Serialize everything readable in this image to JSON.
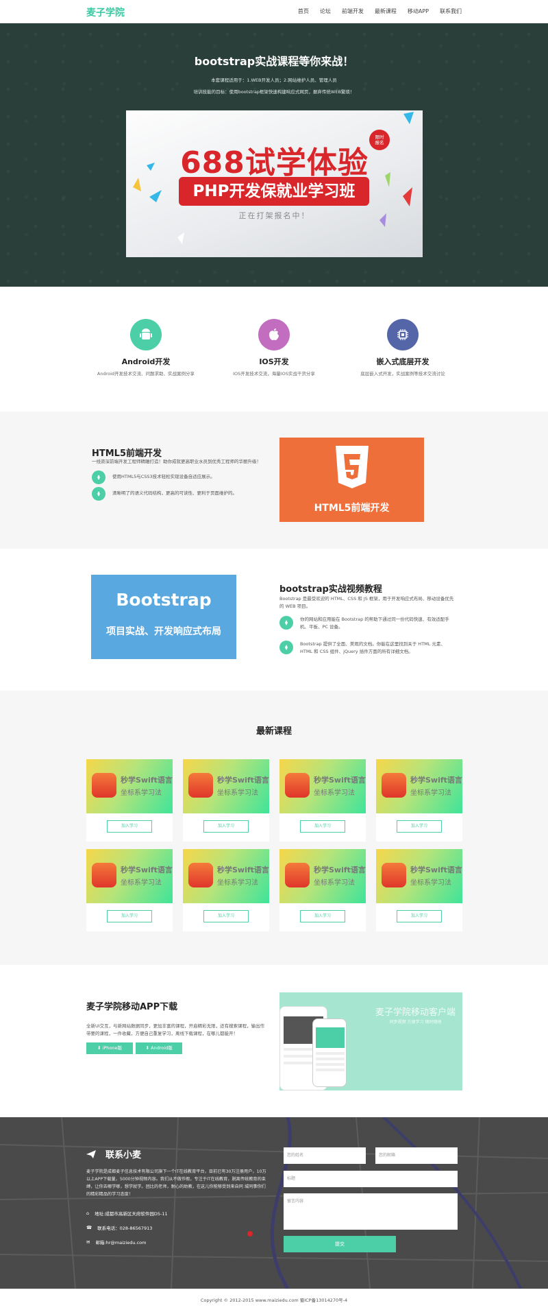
{
  "nav": {
    "brand": "麦子学院",
    "items": [
      "首页",
      "论坛",
      "前端开发",
      "最新课程",
      "移动APP",
      "联系我们"
    ]
  },
  "hero": {
    "title": "bootstrap实战课程等你来战！",
    "line1": "本套课程适用于：1.WEB开发人员；2.网站维护人员、管理人员",
    "line2": "培训技能的目标：使用bootstrap框架快速构建响应式网页，摒弃传统WEB繁琐！",
    "banner": {
      "big": "688试学体验",
      "badge_line1": "限时",
      "badge_line2": "报名",
      "red": "PHP开发保就业学习班",
      "small": "正在打架报名中！"
    }
  },
  "features": [
    {
      "title": "Android开发",
      "desc": "Android开发技术交流、问题求助、实战案例分享",
      "icon": "android-icon",
      "color": "#4ccfa6"
    },
    {
      "title": "IOS开发",
      "desc": "IOS开发技术交流，海量IOS实战干货分享",
      "icon": "apple-icon",
      "color": "#c26dc0"
    },
    {
      "title": "嵌入式底层开发",
      "desc": "底层嵌入式开发，实战案例等技术交流讨论",
      "icon": "chip-icon",
      "color": "#5566a8"
    }
  ],
  "html5": {
    "title": "HTML5前端开发",
    "desc": "一线资深前端开发工程师精雕打造！助你成就更高职业水员到优秀工程师的华丽升级！",
    "bullets": [
      "使用HTML5与CSS3技术轻松实现设备自适应展示。",
      "清晰明了的语义代码结构，更高的可读性、更利于页面维护的。"
    ],
    "image_title": "HTML5前端开发"
  },
  "bootstrap": {
    "title": "bootstrap实战视频教程",
    "desc": "Bootstrap 是最受欢迎的 HTML、CSS 和 JS 框架，用于开发响应式布局、移动设备优先的 WEB 项目。",
    "bullets": [
      "你的网站和应用能在 Bootstrap 的帮助下通过同一份代码快速、有效适配手机、平板、PC 设备。",
      "Bootstrap 提供了全面、美观的文档。你能在这里找到关于 HTML 元素、HTML 和 CSS 组件、jQuery 插件方面的所有详细文档。"
    ],
    "image_title": "Bootstrap",
    "image_sub": "项目实战、开发响应式布局"
  },
  "courses": {
    "title": "最新课程",
    "thumb_line1": "秒学Swift语言",
    "thumb_line2": "坐标系学习法",
    "button": "加入学习",
    "count": 8
  },
  "app": {
    "title": "麦子学院移动APP下载",
    "desc": "全新UI交互，与新网站数据同步，更加丰富的课程，开启精彩无限，还有搜索课程，输出作带要的课程，一件收藏，方便自己重复学习，离线下载课程，在哪儿都能开！",
    "btn_iphone": "iPhone版",
    "btn_android": "Android版",
    "image_title": "麦子学院移动客户端",
    "image_sub": "同步视频 方便学习 随时随地"
  },
  "contact": {
    "title": "联系小麦",
    "desc": "麦子学院是成都麦子信息技术有限公司旗下一个IT在线教育平台，目前已有30万注册用户，10万以上APP下载量，5000分钟视频内容。我们从不做作假，专注于IT在线教育，脱离传统教育的束缚，让你去哪学哪，想学就学。团比的老师，耐心的助教，在这儿你能够受到来自同 城同事你们的精彩精品的学习态度！",
    "address": "地址:成都市高新区天府软件园D5-11",
    "phone": "联系电话：028-86567913",
    "email": "邮箱:hr@maiziedu.com",
    "name_placeholder": "您的姓名",
    "email_placeholder": "您的邮箱",
    "subject_placeholder": "标题",
    "message_placeholder": "留言内容",
    "submit": "提交"
  },
  "footer": {
    "text": "Copyright © 2012-2015  www.maiziedu.com  蜀ICP备13014270号-4"
  },
  "colors": {
    "accent": "#4ccfa6",
    "hero_bg": "#2a3f39",
    "html5_orange": "#ef6f3a",
    "bootstrap_blue": "#5aa8e0"
  }
}
